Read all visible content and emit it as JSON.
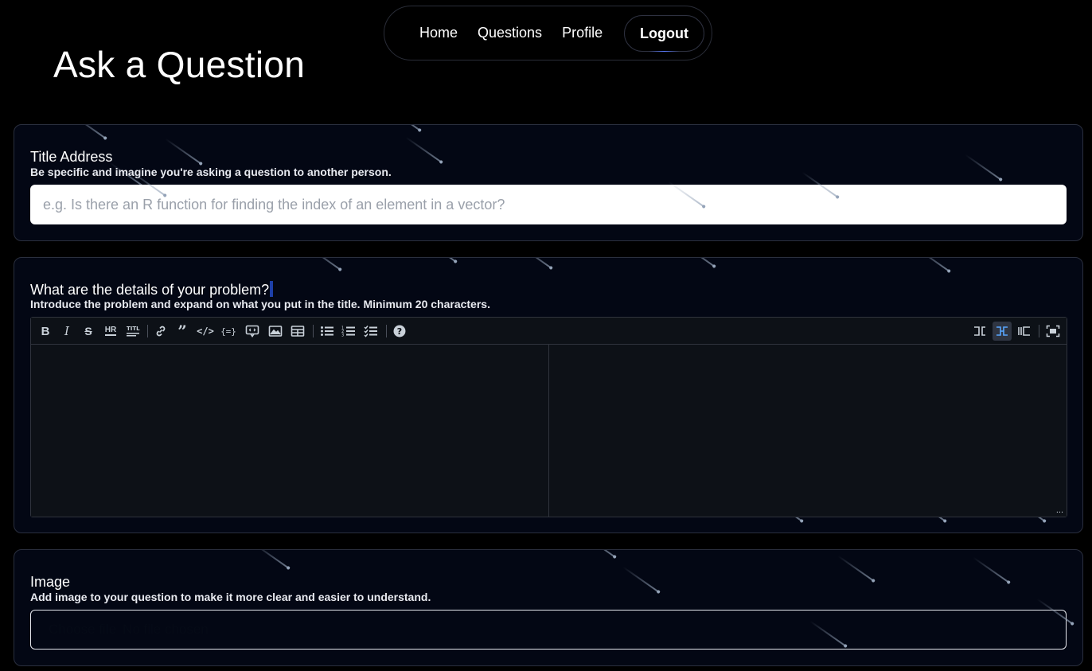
{
  "nav": {
    "home": "Home",
    "questions": "Questions",
    "profile": "Profile",
    "logout": "Logout"
  },
  "page": {
    "title": "Ask a Question"
  },
  "title_section": {
    "label": "Title Address",
    "hint": "Be specific and imagine you're asking a question to another person.",
    "placeholder": "e.g. Is there an R function for finding the index of an element in a vector?"
  },
  "details_section": {
    "label": "What are the details of your problem?",
    "hint": "Introduce the problem and expand on what you put in the title. Minimum 20 characters.",
    "toolbar_left": [
      "bold-icon",
      "italic-icon",
      "strikethrough-icon",
      "hr-icon",
      "title-icon",
      "link-icon",
      "quote-icon",
      "code-icon",
      "code-block-icon",
      "comment-icon",
      "image-icon",
      "table-icon",
      "unordered-list-icon",
      "ordered-list-icon",
      "checked-list-icon",
      "help-icon"
    ],
    "toolbar_right": [
      "edit-mode-icon",
      "live-mode-icon",
      "preview-mode-icon",
      "fullscreen-icon"
    ],
    "active_mode": "live-mode-icon",
    "resize_handle": "..."
  },
  "image_section": {
    "label": "Image",
    "hint": "Add image to your question to make it more clear and easier to understand.",
    "file_button": "Choose file",
    "file_status": "No file chosen"
  },
  "colors": {
    "background": "#000000",
    "card": "#030714",
    "editor": "#0d1117",
    "accent": "#58a6ff"
  }
}
